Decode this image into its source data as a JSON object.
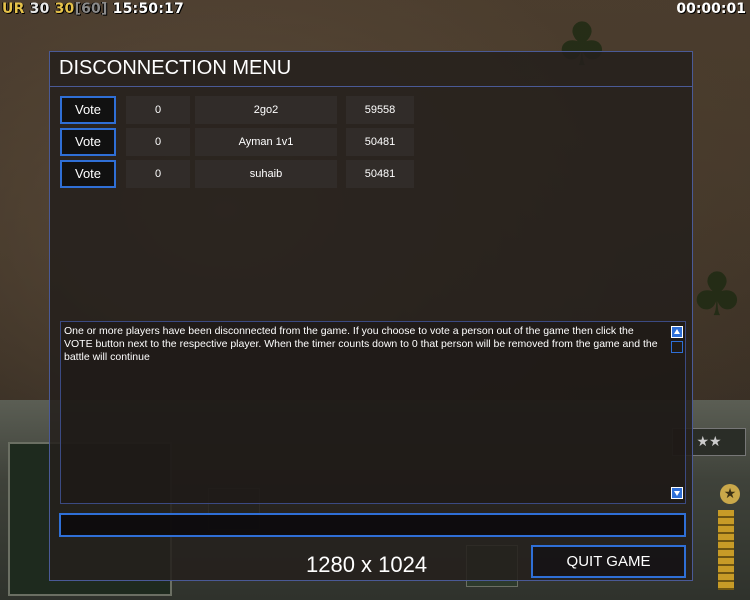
{
  "hud": {
    "ur_label": "UR",
    "value_a": "30",
    "value_b": "30",
    "value_c": "[60]",
    "clock": "15:50:17",
    "elapsed": "00:00:01"
  },
  "console": {
    "stars_label": "★★"
  },
  "dialog": {
    "title": "DISCONNECTION MENU",
    "vote_label": "Vote",
    "players": [
      {
        "votes": "0",
        "name": "2go2",
        "id": "59558"
      },
      {
        "votes": "0",
        "name": "Ayman 1v1",
        "id": "50481"
      },
      {
        "votes": "0",
        "name": "suhaib",
        "id": "50481"
      }
    ],
    "message": "One or more players have been disconnected from the game. If you choose to vote a person out of the game then click the VOTE button next to the respective player. When the timer counts down to 0 that person will be removed from the game and the battle will continue",
    "chat_value": "",
    "quit_label": "QUIT GAME",
    "resolution": "1280 x 1024"
  },
  "colors": {
    "accent": "#2f6fd6",
    "border": "#4a5a96"
  },
  "icons": [
    "palm-tree-icon",
    "scroll-up-icon",
    "scroll-down-icon",
    "star-icon"
  ]
}
